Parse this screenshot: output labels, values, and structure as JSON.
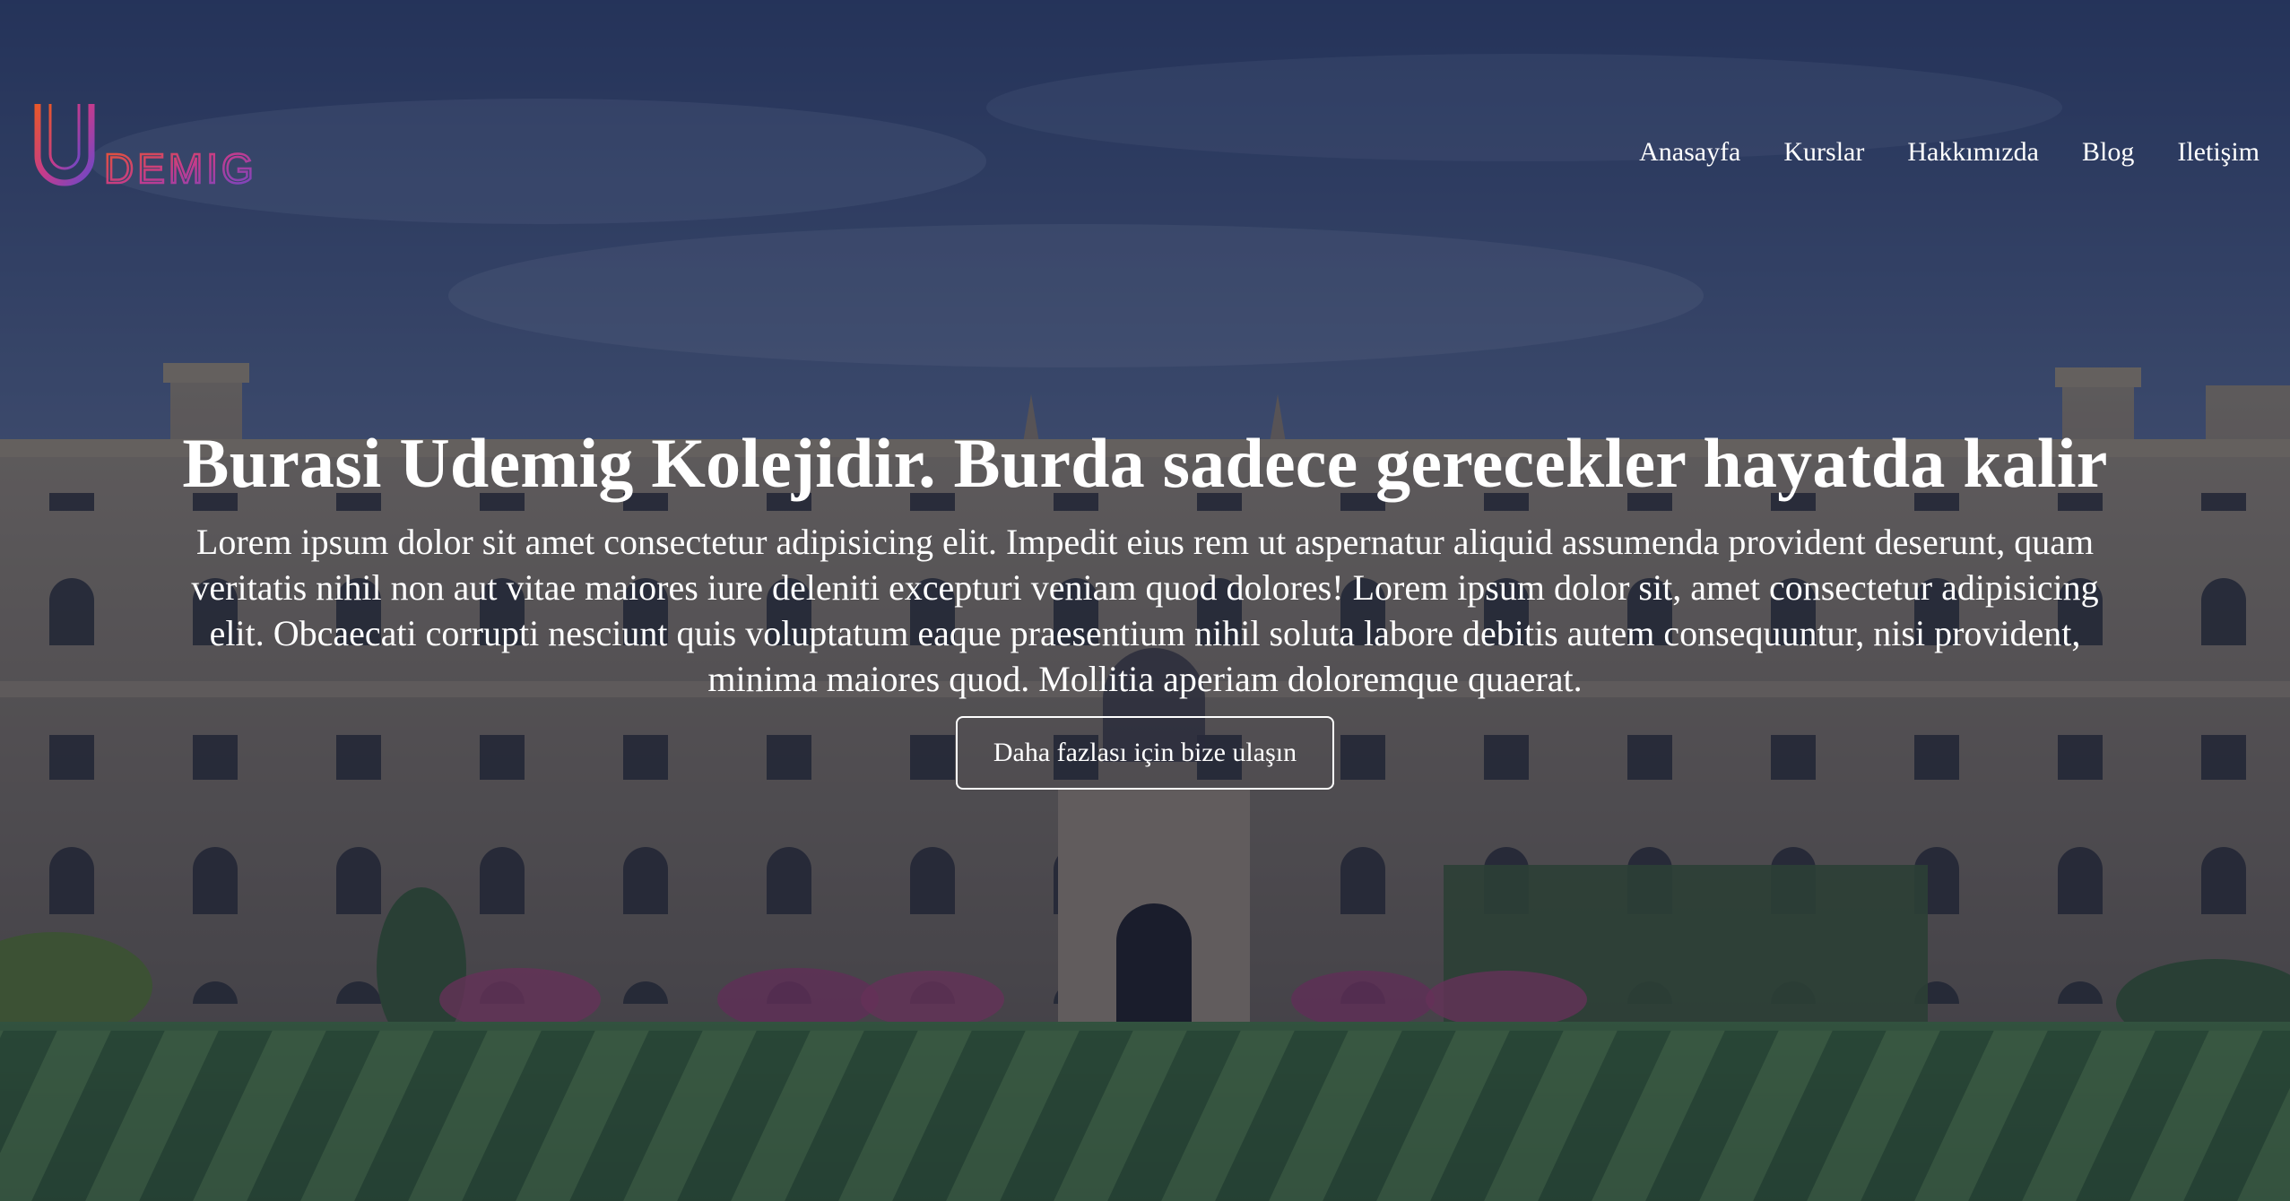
{
  "header": {
    "logo_text": "UDEMIG",
    "logo_colors": [
      "#e8572a",
      "#c43b8d",
      "#6a48c9"
    ],
    "nav": [
      {
        "label": "Anasayfa"
      },
      {
        "label": "Kurslar"
      },
      {
        "label": "Hakkımızda"
      },
      {
        "label": "Blog"
      },
      {
        "label": "Iletişim"
      }
    ]
  },
  "hero": {
    "background": "college-courtyard-photo",
    "title": "Burasi Udemig Kolejidir. Burda sadece gerecekler hayatda kalir",
    "description": "Lorem ipsum dolor sit amet consectetur adipisicing elit. Impedit eius rem ut aspernatur aliquid assumenda provident deserunt, quam veritatis nihil non aut vitae maiores iure deleniti excepturi veniam quod dolores! Lorem ipsum dolor sit, amet consectetur adipisicing elit. Obcaecati corrupti nesciunt quis voluptatum eaque praesentium nihil soluta labore debitis autem consequuntur, nisi provident, minima maiores quod. Mollitia aperiam doloremque quaerat.",
    "cta_label": "Daha fazlası için bize ulaşın"
  },
  "colors": {
    "overlay": "#141e41",
    "text": "#ffffff",
    "sky": "#3e5080",
    "stone": "#8c7c66",
    "grass_light": "#3e6e34",
    "grass_dark": "#274a22"
  }
}
